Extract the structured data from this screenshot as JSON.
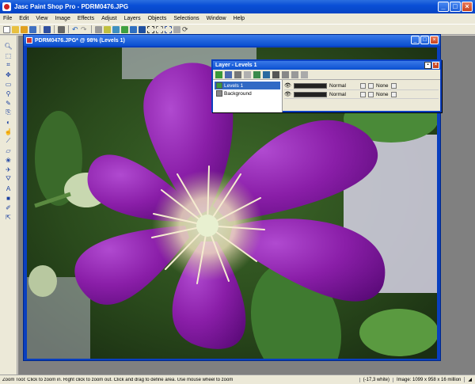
{
  "window": {
    "title": "Jasc Paint Shop Pro - PDRM0476.JPG"
  },
  "menu": [
    "File",
    "Edit",
    "View",
    "Image",
    "Effects",
    "Adjust",
    "Layers",
    "Objects",
    "Selections",
    "Window",
    "Help"
  ],
  "document": {
    "title": "PDRM0476.JPG* @ 98% (Levels 1)"
  },
  "layers_palette": {
    "title": "Layer - Levels 1",
    "layers": [
      {
        "name": "Levels 1",
        "blend": "Normal",
        "opacity": 1.0,
        "selected": true
      },
      {
        "name": "Background",
        "blend": "Normal",
        "opacity": 1.0,
        "selected": false
      }
    ],
    "none_label": "None"
  },
  "status": {
    "message": "Zoom Tool: Click to zoom in. Right click to zoom out. Click and drag to define area. Use mouse wheel to zoom",
    "cursor": "(-17,3 white)",
    "image_info": "Image: 1099 x 958 x 16 million"
  },
  "colors": {
    "title_blue": "#0a4fd6",
    "chrome": "#ece9d8",
    "workspace": "#808080"
  }
}
